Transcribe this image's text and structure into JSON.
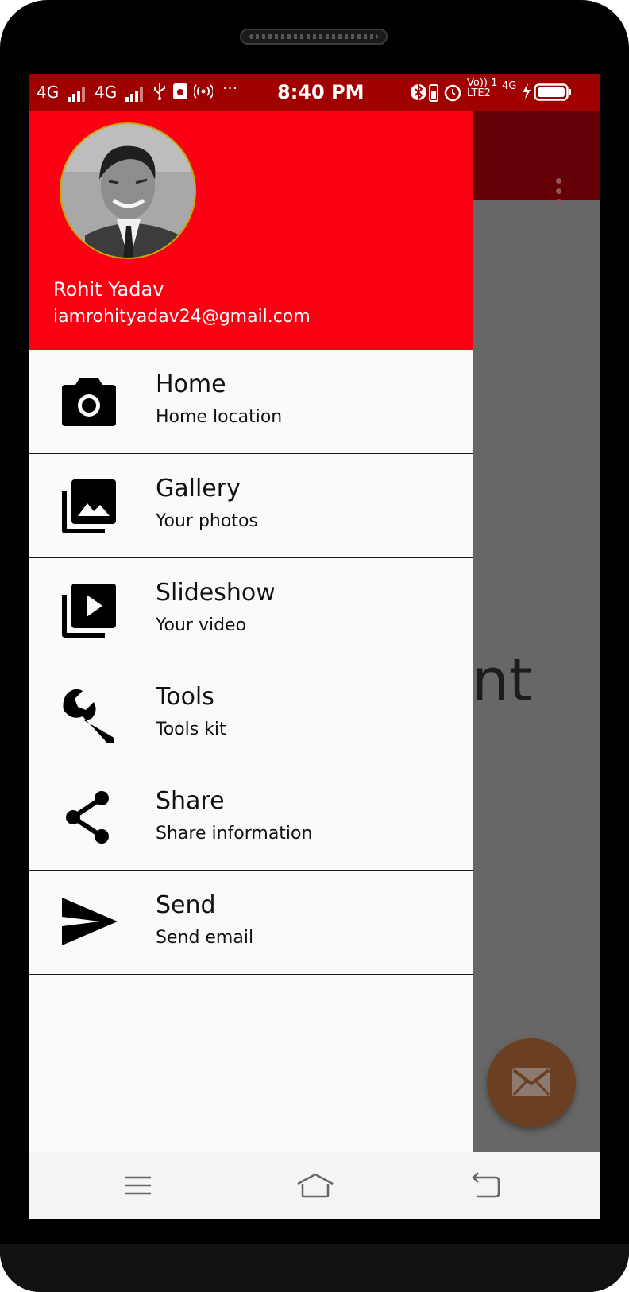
{
  "status_bar": {
    "network_1": "4G",
    "network_2": "4G",
    "time": "8:40 PM",
    "volte_label": "Vo)) 1",
    "lte_label": "LTE2",
    "network_3": "4G",
    "icons": [
      "signal-icon",
      "signal-icon",
      "usb-icon",
      "app-notification-icon",
      "hotspot-icon",
      "more-dots-icon",
      "bluetooth-icon",
      "battery-saver-icon",
      "alarm-icon",
      "charging-icon",
      "battery-icon"
    ]
  },
  "background_app": {
    "text_fragment": "nt",
    "overflow_icon": "more-vert-icon",
    "fab_icon": "email-icon"
  },
  "drawer": {
    "header": {
      "user_name": "Rohit Yadav",
      "user_email": "iamrohityadav24@gmail.com"
    },
    "items": [
      {
        "title": "Home",
        "subtitle": "Home location",
        "icon": "camera-icon"
      },
      {
        "title": "Gallery",
        "subtitle": "Your photos",
        "icon": "gallery-icon"
      },
      {
        "title": "Slideshow",
        "subtitle": "Your video",
        "icon": "slideshow-icon"
      },
      {
        "title": "Tools",
        "subtitle": "Tools kit",
        "icon": "wrench-icon"
      },
      {
        "title": "Share",
        "subtitle": "Share information",
        "icon": "share-icon"
      },
      {
        "title": "Send",
        "subtitle": "Send email",
        "icon": "send-icon"
      }
    ]
  },
  "nav_bar": {
    "buttons": [
      "menu-icon",
      "home-icon",
      "back-icon"
    ]
  },
  "colors": {
    "header_red": "#f90012",
    "status_bar_red": "#a10000",
    "toolbar_dark_red": "#650006",
    "scrim_gray": "#676767",
    "fab_brown": "#6a3f22"
  }
}
